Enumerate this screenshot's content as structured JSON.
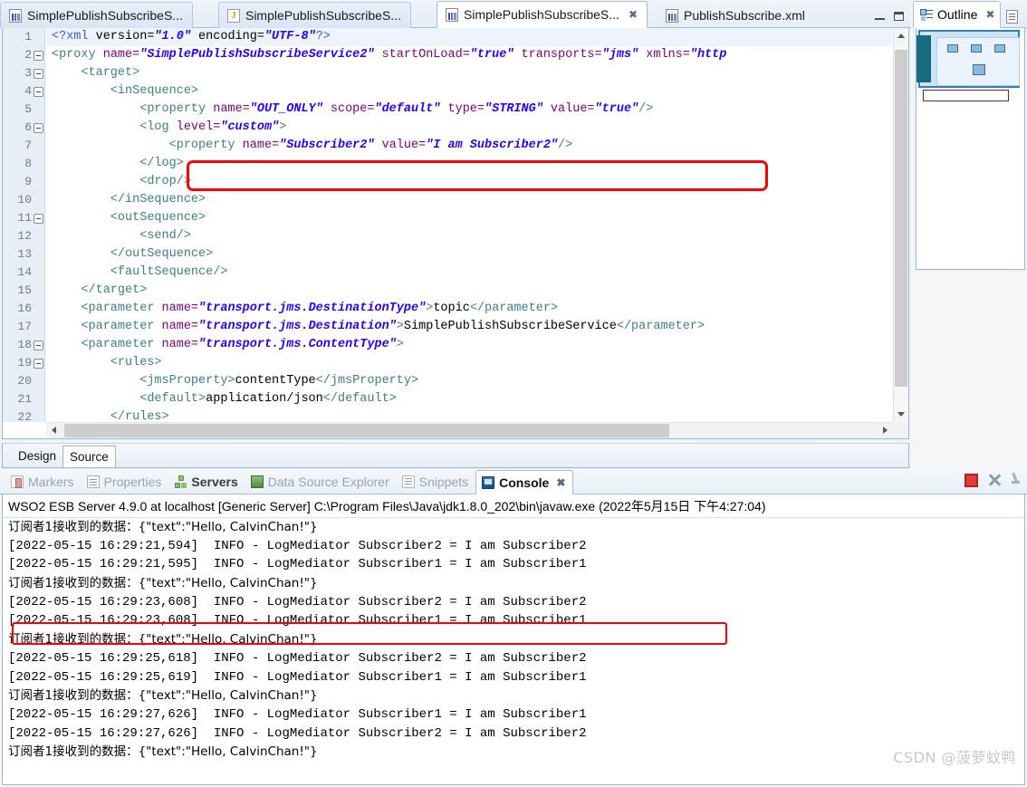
{
  "editor": {
    "tabs": [
      {
        "label": "SimplePublishSubscribeS...",
        "icon": "xml-file-icon",
        "active": false,
        "closable": false
      },
      {
        "label": "SimplePublishSubscribeS...",
        "icon": "java-file-icon",
        "active": false,
        "closable": false
      },
      {
        "label": "SimplePublishSubscribeS...",
        "icon": "xml-file-icon",
        "active": true,
        "closable": true
      },
      {
        "label": "PublishSubscribe.xml",
        "icon": "xml-file-icon",
        "active": false,
        "closable": false
      }
    ],
    "window_controls": {
      "minimize": "minimize-icon",
      "maximize": "maximize-icon"
    },
    "bottom_tabs": [
      {
        "label": "Design",
        "selected": false
      },
      {
        "label": "Source",
        "selected": true
      }
    ],
    "lines": [
      {
        "n": "1",
        "fold": false,
        "highlight": true,
        "segments": [
          {
            "t": "<?xml ",
            "c": "pi"
          },
          {
            "t": "version=",
            "c": "tx"
          },
          {
            "t": "\"1.0\"",
            "c": "av"
          },
          {
            "t": " encoding=",
            "c": "tx"
          },
          {
            "t": "\"UTF-8\"",
            "c": "av"
          },
          {
            "t": "?>",
            "c": "pi"
          }
        ]
      },
      {
        "n": "2",
        "fold": true,
        "highlight": false,
        "segments": [
          {
            "t": "<proxy ",
            "c": "tg"
          },
          {
            "t": "name=",
            "c": "at"
          },
          {
            "t": "\"SimplePublishSubscribeService2\"",
            "c": "av"
          },
          {
            "t": " startOnLoad=",
            "c": "at"
          },
          {
            "t": "\"true\"",
            "c": "av"
          },
          {
            "t": " transports=",
            "c": "at"
          },
          {
            "t": "\"jms\"",
            "c": "av"
          },
          {
            "t": " xmlns=",
            "c": "at"
          },
          {
            "t": "\"http",
            "c": "av"
          }
        ]
      },
      {
        "n": "3",
        "fold": true,
        "highlight": false,
        "segments": [
          {
            "t": "    <target>",
            "c": "tg"
          }
        ]
      },
      {
        "n": "4",
        "fold": true,
        "highlight": false,
        "segments": [
          {
            "t": "        <inSequence>",
            "c": "tg"
          }
        ]
      },
      {
        "n": "5",
        "fold": false,
        "highlight": false,
        "segments": [
          {
            "t": "            <property ",
            "c": "tg"
          },
          {
            "t": "name=",
            "c": "at"
          },
          {
            "t": "\"OUT_ONLY\"",
            "c": "av"
          },
          {
            "t": " scope=",
            "c": "at"
          },
          {
            "t": "\"default\"",
            "c": "av"
          },
          {
            "t": " type=",
            "c": "at"
          },
          {
            "t": "\"STRING\"",
            "c": "av"
          },
          {
            "t": " value=",
            "c": "at"
          },
          {
            "t": "\"true\"",
            "c": "av"
          },
          {
            "t": "/>",
            "c": "tg"
          }
        ]
      },
      {
        "n": "6",
        "fold": true,
        "highlight": false,
        "segments": [
          {
            "t": "            <log ",
            "c": "tg"
          },
          {
            "t": "level=",
            "c": "at"
          },
          {
            "t": "\"custom\"",
            "c": "av"
          },
          {
            "t": ">",
            "c": "tg"
          }
        ]
      },
      {
        "n": "7",
        "fold": false,
        "highlight": false,
        "segments": [
          {
            "t": "                <property ",
            "c": "tg"
          },
          {
            "t": "name=",
            "c": "at"
          },
          {
            "t": "\"Subscriber2\"",
            "c": "av"
          },
          {
            "t": " value=",
            "c": "at"
          },
          {
            "t": "\"I am Subscriber2\"",
            "c": "av"
          },
          {
            "t": "/>",
            "c": "tg"
          }
        ]
      },
      {
        "n": "8",
        "fold": false,
        "highlight": false,
        "segments": [
          {
            "t": "            </log>",
            "c": "tg"
          }
        ]
      },
      {
        "n": "9",
        "fold": false,
        "highlight": false,
        "segments": [
          {
            "t": "            <drop/>",
            "c": "tg"
          }
        ]
      },
      {
        "n": "10",
        "fold": false,
        "highlight": false,
        "segments": [
          {
            "t": "        </inSequence>",
            "c": "tg"
          }
        ]
      },
      {
        "n": "11",
        "fold": true,
        "highlight": false,
        "segments": [
          {
            "t": "        <outSequence>",
            "c": "tg"
          }
        ]
      },
      {
        "n": "12",
        "fold": false,
        "highlight": false,
        "segments": [
          {
            "t": "            <send/>",
            "c": "tg"
          }
        ]
      },
      {
        "n": "13",
        "fold": false,
        "highlight": false,
        "segments": [
          {
            "t": "        </outSequence>",
            "c": "tg"
          }
        ]
      },
      {
        "n": "14",
        "fold": false,
        "highlight": false,
        "segments": [
          {
            "t": "        <faultSequence/>",
            "c": "tg"
          }
        ]
      },
      {
        "n": "15",
        "fold": false,
        "highlight": false,
        "segments": [
          {
            "t": "    </target>",
            "c": "tg"
          }
        ]
      },
      {
        "n": "16",
        "fold": false,
        "highlight": false,
        "segments": [
          {
            "t": "    <parameter ",
            "c": "tg"
          },
          {
            "t": "name=",
            "c": "at"
          },
          {
            "t": "\"transport.jms.DestinationType\"",
            "c": "av"
          },
          {
            "t": ">",
            "c": "tg"
          },
          {
            "t": "topic",
            "c": "tx"
          },
          {
            "t": "</parameter>",
            "c": "tg"
          }
        ]
      },
      {
        "n": "17",
        "fold": false,
        "highlight": false,
        "segments": [
          {
            "t": "    <parameter ",
            "c": "tg"
          },
          {
            "t": "name=",
            "c": "at"
          },
          {
            "t": "\"transport.jms.Destination\"",
            "c": "av"
          },
          {
            "t": ">",
            "c": "tg"
          },
          {
            "t": "SimplePublishSubscribeService",
            "c": "tx"
          },
          {
            "t": "</parameter>",
            "c": "tg"
          }
        ]
      },
      {
        "n": "18",
        "fold": true,
        "highlight": false,
        "segments": [
          {
            "t": "    <parameter ",
            "c": "tg"
          },
          {
            "t": "name=",
            "c": "at"
          },
          {
            "t": "\"transport.jms.ContentType\"",
            "c": "av"
          },
          {
            "t": ">",
            "c": "tg"
          }
        ]
      },
      {
        "n": "19",
        "fold": true,
        "highlight": false,
        "segments": [
          {
            "t": "        <rules>",
            "c": "tg"
          }
        ]
      },
      {
        "n": "20",
        "fold": false,
        "highlight": false,
        "segments": [
          {
            "t": "            <jmsProperty>",
            "c": "tg"
          },
          {
            "t": "contentType",
            "c": "tx"
          },
          {
            "t": "</jmsProperty>",
            "c": "tg"
          }
        ]
      },
      {
        "n": "21",
        "fold": false,
        "highlight": false,
        "segments": [
          {
            "t": "            <default>",
            "c": "tg"
          },
          {
            "t": "application/json",
            "c": "tx"
          },
          {
            "t": "</default>",
            "c": "tg"
          }
        ]
      },
      {
        "n": "22",
        "fold": false,
        "highlight": false,
        "segments": [
          {
            "t": "        </rules>",
            "c": "tg"
          }
        ]
      }
    ]
  },
  "outline": {
    "tab_label": "Outline",
    "close_icon": "close-icon",
    "menu_icon": "view-menu-icon"
  },
  "console": {
    "tabs": [
      {
        "label": "Markers",
        "icon": "markers-icon",
        "state": "inactive"
      },
      {
        "label": "Properties",
        "icon": "properties-icon",
        "state": "inactive"
      },
      {
        "label": "Servers",
        "icon": "servers-icon",
        "state": "bold"
      },
      {
        "label": "Data Source Explorer",
        "icon": "data-source-explorer-icon",
        "state": "inactive"
      },
      {
        "label": "Snippets",
        "icon": "snippets-icon",
        "state": "inactive"
      },
      {
        "label": "Console",
        "icon": "console-icon",
        "state": "active"
      }
    ],
    "toolbar": [
      {
        "name": "stop-button",
        "icon": "stop-icon"
      },
      {
        "name": "remove-all-terminated-button",
        "icon": "close-x-icon"
      },
      {
        "name": "pin-console-button",
        "icon": "pin-icon"
      }
    ],
    "header": "WSO2 ESB Server 4.9.0 at localhost [Generic Server] C:\\Program Files\\Java\\jdk1.8.0_202\\bin\\javaw.exe (2022年5月15日 下午4:27:04)",
    "lines": [
      {
        "text": "订阅者1接收到的数据：{\"text\":\"Hello, CalvinChan!\"}",
        "cjk": true,
        "highlight": false
      },
      {
        "text": "[2022-05-15 16:29:21,594]  INFO - LogMediator Subscriber2 = I am Subscriber2",
        "cjk": false,
        "highlight": false
      },
      {
        "text": "[2022-05-15 16:29:21,595]  INFO - LogMediator Subscriber1 = I am Subscriber1",
        "cjk": false,
        "highlight": false
      },
      {
        "text": "订阅者1接收到的数据：{\"text\":\"Hello, CalvinChan!\"}",
        "cjk": true,
        "highlight": false
      },
      {
        "text": "[2022-05-15 16:29:23,608]  INFO - LogMediator Subscriber2 = I am Subscriber2",
        "cjk": false,
        "highlight": true
      },
      {
        "text": "[2022-05-15 16:29:23,608]  INFO - LogMediator Subscriber1 = I am Subscriber1",
        "cjk": false,
        "highlight": false
      },
      {
        "text": "订阅者1接收到的数据：{\"text\":\"Hello, CalvinChan!\"}",
        "cjk": true,
        "highlight": false
      },
      {
        "text": "[2022-05-15 16:29:25,618]  INFO - LogMediator Subscriber2 = I am Subscriber2",
        "cjk": false,
        "highlight": false
      },
      {
        "text": "[2022-05-15 16:29:25,619]  INFO - LogMediator Subscriber1 = I am Subscriber1",
        "cjk": false,
        "highlight": false
      },
      {
        "text": "订阅者1接收到的数据：{\"text\":\"Hello, CalvinChan!\"}",
        "cjk": true,
        "highlight": false
      },
      {
        "text": "[2022-05-15 16:29:27,626]  INFO - LogMediator Subscriber1 = I am Subscriber1",
        "cjk": false,
        "highlight": false
      },
      {
        "text": "[2022-05-15 16:29:27,626]  INFO - LogMediator Subscriber2 = I am Subscriber2",
        "cjk": false,
        "highlight": false
      },
      {
        "text": "订阅者1接收到的数据：{\"text\":\"Hello, CalvinChan!\"}",
        "cjk": true,
        "highlight": false
      }
    ]
  },
  "watermark": "CSDN @菠萝蚊鸭",
  "colors": {
    "annotation_red": "#ff0000",
    "tag": "#3f7f7f",
    "attr_name": "#7f007f",
    "attr_value": "#2a00ff",
    "accent_blue": "#2b7fc4"
  }
}
